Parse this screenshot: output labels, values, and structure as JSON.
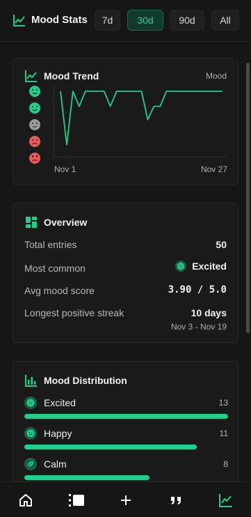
{
  "header": {
    "title": "Mood Stats",
    "ranges": [
      {
        "label": "7d",
        "active": false
      },
      {
        "label": "30d",
        "active": true
      },
      {
        "label": "90d",
        "active": false
      },
      {
        "label": "All",
        "active": false
      }
    ]
  },
  "colors": {
    "accent": "#1fcf8c",
    "accent_dark": "#1d5f45",
    "negative": "#e85c5c",
    "neutral": "#9a9a9a"
  },
  "trend": {
    "title": "Mood Trend",
    "legend_label": "Mood",
    "mood_levels": [
      {
        "icon": "excited-face-icon",
        "color": "#1fcf8c"
      },
      {
        "icon": "happy-face-icon",
        "color": "#1fcf8c"
      },
      {
        "icon": "neutral-face-icon",
        "color": "#9a9a9a"
      },
      {
        "icon": "sad-face-icon",
        "color": "#e85c5c"
      },
      {
        "icon": "angry-face-icon",
        "color": "#e85c5c"
      }
    ],
    "x_start": "Nov 1",
    "x_end": "Nov 27"
  },
  "chart_data": {
    "type": "line",
    "title": "Mood Trend",
    "x": [
      1,
      2,
      3,
      4,
      5,
      6,
      7,
      8,
      9,
      10,
      11,
      12,
      13,
      14,
      15,
      16,
      17,
      18,
      19,
      20,
      21,
      22,
      23,
      24,
      25,
      26,
      27
    ],
    "series": [
      {
        "name": "Mood",
        "values": [
          5.0,
          1.8,
          5.0,
          4.1,
          5.0,
          5.0,
          5.0,
          5.0,
          4.1,
          5.0,
          5.0,
          5.0,
          5.0,
          5.0,
          3.3,
          4.1,
          4.1,
          5.0,
          5.0,
          5.0,
          5.0,
          5.0,
          5.0,
          5.0,
          5.0,
          5.0,
          5.0
        ]
      }
    ],
    "xlabel": "",
    "ylabel": "",
    "ylim": [
      1,
      5
    ],
    "x_tick_labels": [
      "Nov 1",
      "Nov 27"
    ],
    "grid": false
  },
  "overview": {
    "title": "Overview",
    "total_entries_label": "Total entries",
    "total_entries_value": "50",
    "most_common_label": "Most common",
    "most_common_value": "Excited",
    "avg_label": "Avg mood score",
    "avg_value": "3.90 / 5.0",
    "streak_label": "Longest positive streak",
    "streak_value": "10 days",
    "streak_range": "Nov 3 - Nov 19"
  },
  "distribution": {
    "title": "Mood Distribution",
    "max": 13,
    "items": [
      {
        "name": "Excited",
        "count": "13",
        "value": 13,
        "icon": "excited-face-icon"
      },
      {
        "name": "Happy",
        "count": "11",
        "value": 11,
        "icon": "happy-face-icon"
      },
      {
        "name": "Calm",
        "count": "8",
        "value": 8,
        "icon": "leaf-icon"
      }
    ]
  },
  "nav": {
    "items": [
      {
        "icon": "home-icon",
        "active": false
      },
      {
        "icon": "entries-icon",
        "active": false
      },
      {
        "icon": "add-icon",
        "active": false
      },
      {
        "icon": "quote-icon",
        "active": false
      },
      {
        "icon": "stats-chart-icon",
        "active": true
      }
    ]
  }
}
